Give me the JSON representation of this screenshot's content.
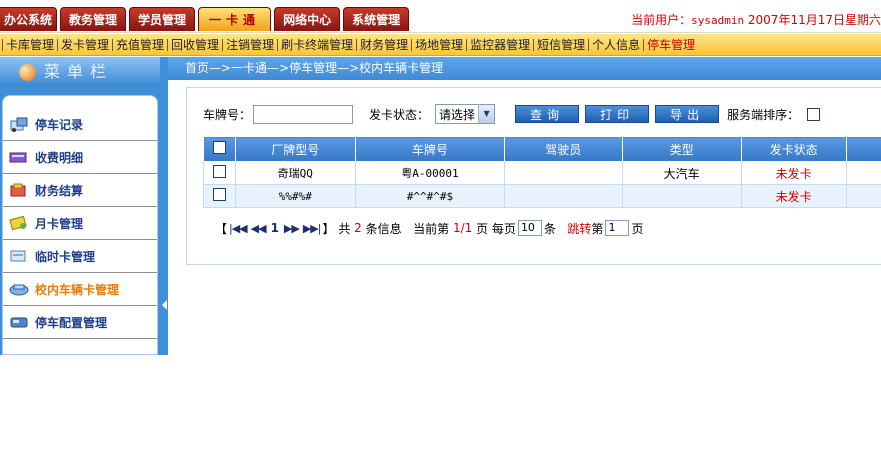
{
  "top_tabs": [
    {
      "label": "办公系统",
      "active": false
    },
    {
      "label": "教务管理",
      "active": false
    },
    {
      "label": "学员管理",
      "active": false
    },
    {
      "label": "一卡通",
      "active": true
    },
    {
      "label": "网络中心",
      "active": false
    },
    {
      "label": "系统管理",
      "active": false
    }
  ],
  "user": {
    "prefix": "当前用户：",
    "name": "sysadmin",
    "date": "2007年11月17日星期六"
  },
  "submenu": [
    "卡库管理",
    "发卡管理",
    "充值管理",
    "回收管理",
    "注销管理",
    "刷卡终端管理",
    "财务管理",
    "场地管理",
    "监控器管理",
    "短信管理",
    "个人信息",
    "停车管理"
  ],
  "submenu_current_index": 11,
  "sidebar": {
    "title": "菜单栏",
    "items": [
      {
        "label": "停车记录",
        "icon": "car-record-icon",
        "active": false
      },
      {
        "label": "收费明细",
        "icon": "fee-detail-icon",
        "active": false
      },
      {
        "label": "财务结算",
        "icon": "finance-icon",
        "active": false
      },
      {
        "label": "月卡管理",
        "icon": "monthly-card-icon",
        "active": false
      },
      {
        "label": "临时卡管理",
        "icon": "temp-card-icon",
        "active": false
      },
      {
        "label": "校内车辆卡管理",
        "icon": "campus-vehicle-card-icon",
        "active": true
      },
      {
        "label": "停车配置管理",
        "icon": "parking-config-icon",
        "active": false
      }
    ]
  },
  "breadcrumb": "首页—>一卡通—>停车管理—>校内车辆卡管理",
  "search": {
    "plate_label": "车牌号：",
    "plate_value": "",
    "status_label": "发卡状态：",
    "status_value": "请选择",
    "query_button": "查询",
    "print_button": "打印",
    "export_button": "导出",
    "sort_label": "服务端排序："
  },
  "table": {
    "headers": [
      "厂牌型号",
      "车牌号",
      "驾驶员",
      "类型",
      "发卡状态"
    ],
    "rows": [
      {
        "model": "奇瑞QQ",
        "plate": "粤A-00001",
        "driver": "",
        "type": "大汽车",
        "status": "未发卡"
      },
      {
        "model": "%%#%#",
        "plate": "#^^#^#$",
        "driver": "",
        "type": "",
        "status": "未发卡"
      }
    ]
  },
  "pager": {
    "open": "【",
    "close": "】",
    "current_page": "1",
    "total_prefix": "共",
    "total": "2",
    "total_suffix": "条信息",
    "page_prefix": "当前第",
    "page_value": "1/1",
    "page_suffix": "页",
    "per_page_prefix": "每页",
    "per_page": "10",
    "per_page_suffix": "条",
    "jump_label": "跳转",
    "jump_prefix": "第",
    "jump_value": "1",
    "jump_suffix": "页"
  },
  "colors": {
    "tab_red": "#a8201a",
    "tab_active": "#f7b52a",
    "sidebar_blue": "#3f8fd9",
    "status_red": "#d00000"
  }
}
